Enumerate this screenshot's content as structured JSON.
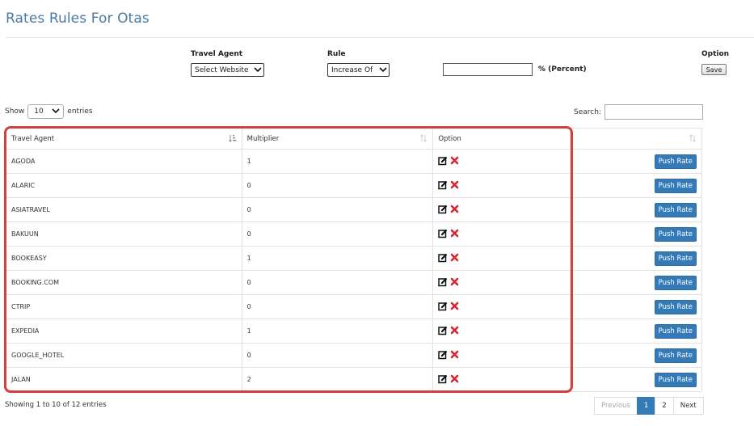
{
  "page": {
    "title": "Rates Rules For Otas"
  },
  "form": {
    "travel_agent_label": "Travel Agent",
    "travel_agent_value": "Select Website",
    "rule_label": "Rule",
    "rule_value": "Increase Of",
    "amount_value": "",
    "percent_text": "%  (Percent)",
    "option_label": "Option",
    "save_label": "Save"
  },
  "length": {
    "show": "Show",
    "value": "10",
    "entries": "entries"
  },
  "search": {
    "label": "Search:",
    "value": ""
  },
  "table": {
    "columns": [
      "Travel Agent",
      "Multiplier",
      "Option",
      ""
    ],
    "push_label": "Push Rate",
    "rows": [
      {
        "agent": "AGODA",
        "multiplier": "1"
      },
      {
        "agent": "ALARIC",
        "multiplier": "0"
      },
      {
        "agent": "ASIATRAVEL",
        "multiplier": "0"
      },
      {
        "agent": "BAKUUN",
        "multiplier": "0"
      },
      {
        "agent": "BOOKEASY",
        "multiplier": "1"
      },
      {
        "agent": "BOOKING.COM",
        "multiplier": "0"
      },
      {
        "agent": "CTRIP",
        "multiplier": "0"
      },
      {
        "agent": "EXPEDIA",
        "multiplier": "1"
      },
      {
        "agent": "GOOGLE_HOTEL",
        "multiplier": "0"
      },
      {
        "agent": "JALAN",
        "multiplier": "2"
      }
    ]
  },
  "footer": {
    "info": "Showing 1 to 10 of 12 entries",
    "previous": "Previous",
    "pages": [
      "1",
      "2"
    ],
    "next": "Next"
  },
  "colors": {
    "accent": "#337ab7",
    "title": "#4a7aa3",
    "highlight": "#d43f3f",
    "delete": "#d9232d"
  },
  "icons": {
    "edit": "edit-icon",
    "delete": "delete-icon",
    "sort": "sort-icon"
  }
}
